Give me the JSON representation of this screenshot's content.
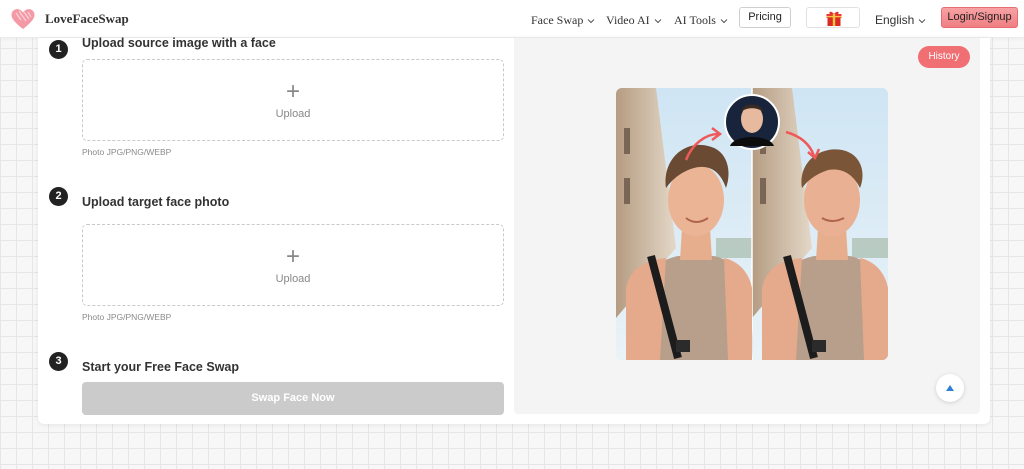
{
  "header": {
    "brand": "LoveFaceSwap",
    "nav": [
      {
        "label": "Face Swap"
      },
      {
        "label": "Video AI"
      },
      {
        "label": "AI Tools"
      }
    ],
    "pricing_label": "Pricing",
    "language": "English",
    "login_label": "Login/Signup",
    "icons": {
      "logo": "heart-logo",
      "gift": "gift-icon",
      "chevron": "chevron-down-icon"
    }
  },
  "steps": [
    {
      "number": "1",
      "title": "Upload source image with a face",
      "upload_label": "Upload",
      "hint": "Photo JPG/PNG/WEBP"
    },
    {
      "number": "2",
      "title": "Upload target face photo",
      "upload_label": "Upload",
      "hint": "Photo JPG/PNG/WEBP"
    },
    {
      "number": "3",
      "title": "Start your Free Face Swap"
    }
  ],
  "swap_button_label": "Swap Face Now",
  "preview": {
    "history_label": "History",
    "image": "face-swap-example"
  },
  "colors": {
    "accent": "#ef6f73",
    "login_button": "#f18f93",
    "disabled_button": "#cbcbcb",
    "step_badge": "#222222"
  }
}
